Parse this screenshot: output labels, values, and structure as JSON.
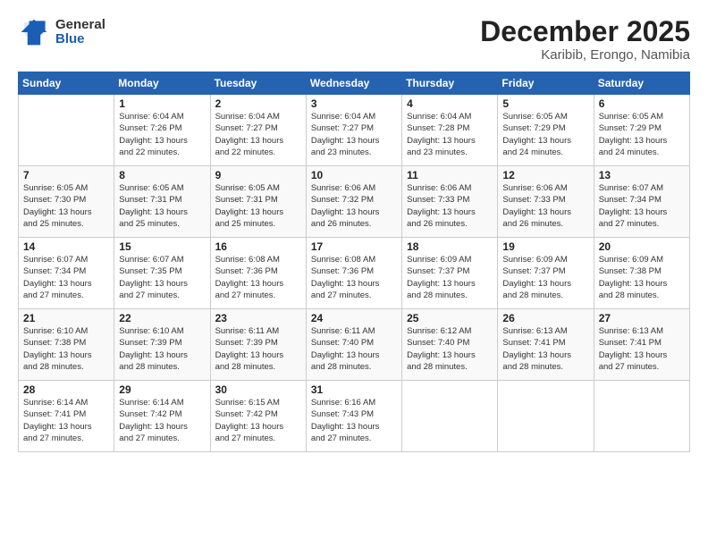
{
  "header": {
    "logo_general": "General",
    "logo_blue": "Blue",
    "month_title": "December 2025",
    "subtitle": "Karibib, Erongo, Namibia"
  },
  "days_of_week": [
    "Sunday",
    "Monday",
    "Tuesday",
    "Wednesday",
    "Thursday",
    "Friday",
    "Saturday"
  ],
  "weeks": [
    [
      {
        "day": "",
        "sunrise": "",
        "sunset": "",
        "daylight": ""
      },
      {
        "day": "1",
        "sunrise": "Sunrise: 6:04 AM",
        "sunset": "Sunset: 7:26 PM",
        "daylight": "Daylight: 13 hours and 22 minutes."
      },
      {
        "day": "2",
        "sunrise": "Sunrise: 6:04 AM",
        "sunset": "Sunset: 7:27 PM",
        "daylight": "Daylight: 13 hours and 22 minutes."
      },
      {
        "day": "3",
        "sunrise": "Sunrise: 6:04 AM",
        "sunset": "Sunset: 7:27 PM",
        "daylight": "Daylight: 13 hours and 23 minutes."
      },
      {
        "day": "4",
        "sunrise": "Sunrise: 6:04 AM",
        "sunset": "Sunset: 7:28 PM",
        "daylight": "Daylight: 13 hours and 23 minutes."
      },
      {
        "day": "5",
        "sunrise": "Sunrise: 6:05 AM",
        "sunset": "Sunset: 7:29 PM",
        "daylight": "Daylight: 13 hours and 24 minutes."
      },
      {
        "day": "6",
        "sunrise": "Sunrise: 6:05 AM",
        "sunset": "Sunset: 7:29 PM",
        "daylight": "Daylight: 13 hours and 24 minutes."
      }
    ],
    [
      {
        "day": "7",
        "sunrise": "Sunrise: 6:05 AM",
        "sunset": "Sunset: 7:30 PM",
        "daylight": "Daylight: 13 hours and 25 minutes."
      },
      {
        "day": "8",
        "sunrise": "Sunrise: 6:05 AM",
        "sunset": "Sunset: 7:31 PM",
        "daylight": "Daylight: 13 hours and 25 minutes."
      },
      {
        "day": "9",
        "sunrise": "Sunrise: 6:05 AM",
        "sunset": "Sunset: 7:31 PM",
        "daylight": "Daylight: 13 hours and 25 minutes."
      },
      {
        "day": "10",
        "sunrise": "Sunrise: 6:06 AM",
        "sunset": "Sunset: 7:32 PM",
        "daylight": "Daylight: 13 hours and 26 minutes."
      },
      {
        "day": "11",
        "sunrise": "Sunrise: 6:06 AM",
        "sunset": "Sunset: 7:33 PM",
        "daylight": "Daylight: 13 hours and 26 minutes."
      },
      {
        "day": "12",
        "sunrise": "Sunrise: 6:06 AM",
        "sunset": "Sunset: 7:33 PM",
        "daylight": "Daylight: 13 hours and 26 minutes."
      },
      {
        "day": "13",
        "sunrise": "Sunrise: 6:07 AM",
        "sunset": "Sunset: 7:34 PM",
        "daylight": "Daylight: 13 hours and 27 minutes."
      }
    ],
    [
      {
        "day": "14",
        "sunrise": "Sunrise: 6:07 AM",
        "sunset": "Sunset: 7:34 PM",
        "daylight": "Daylight: 13 hours and 27 minutes."
      },
      {
        "day": "15",
        "sunrise": "Sunrise: 6:07 AM",
        "sunset": "Sunset: 7:35 PM",
        "daylight": "Daylight: 13 hours and 27 minutes."
      },
      {
        "day": "16",
        "sunrise": "Sunrise: 6:08 AM",
        "sunset": "Sunset: 7:36 PM",
        "daylight": "Daylight: 13 hours and 27 minutes."
      },
      {
        "day": "17",
        "sunrise": "Sunrise: 6:08 AM",
        "sunset": "Sunset: 7:36 PM",
        "daylight": "Daylight: 13 hours and 27 minutes."
      },
      {
        "day": "18",
        "sunrise": "Sunrise: 6:09 AM",
        "sunset": "Sunset: 7:37 PM",
        "daylight": "Daylight: 13 hours and 28 minutes."
      },
      {
        "day": "19",
        "sunrise": "Sunrise: 6:09 AM",
        "sunset": "Sunset: 7:37 PM",
        "daylight": "Daylight: 13 hours and 28 minutes."
      },
      {
        "day": "20",
        "sunrise": "Sunrise: 6:09 AM",
        "sunset": "Sunset: 7:38 PM",
        "daylight": "Daylight: 13 hours and 28 minutes."
      }
    ],
    [
      {
        "day": "21",
        "sunrise": "Sunrise: 6:10 AM",
        "sunset": "Sunset: 7:38 PM",
        "daylight": "Daylight: 13 hours and 28 minutes."
      },
      {
        "day": "22",
        "sunrise": "Sunrise: 6:10 AM",
        "sunset": "Sunset: 7:39 PM",
        "daylight": "Daylight: 13 hours and 28 minutes."
      },
      {
        "day": "23",
        "sunrise": "Sunrise: 6:11 AM",
        "sunset": "Sunset: 7:39 PM",
        "daylight": "Daylight: 13 hours and 28 minutes."
      },
      {
        "day": "24",
        "sunrise": "Sunrise: 6:11 AM",
        "sunset": "Sunset: 7:40 PM",
        "daylight": "Daylight: 13 hours and 28 minutes."
      },
      {
        "day": "25",
        "sunrise": "Sunrise: 6:12 AM",
        "sunset": "Sunset: 7:40 PM",
        "daylight": "Daylight: 13 hours and 28 minutes."
      },
      {
        "day": "26",
        "sunrise": "Sunrise: 6:13 AM",
        "sunset": "Sunset: 7:41 PM",
        "daylight": "Daylight: 13 hours and 28 minutes."
      },
      {
        "day": "27",
        "sunrise": "Sunrise: 6:13 AM",
        "sunset": "Sunset: 7:41 PM",
        "daylight": "Daylight: 13 hours and 27 minutes."
      }
    ],
    [
      {
        "day": "28",
        "sunrise": "Sunrise: 6:14 AM",
        "sunset": "Sunset: 7:41 PM",
        "daylight": "Daylight: 13 hours and 27 minutes."
      },
      {
        "day": "29",
        "sunrise": "Sunrise: 6:14 AM",
        "sunset": "Sunset: 7:42 PM",
        "daylight": "Daylight: 13 hours and 27 minutes."
      },
      {
        "day": "30",
        "sunrise": "Sunrise: 6:15 AM",
        "sunset": "Sunset: 7:42 PM",
        "daylight": "Daylight: 13 hours and 27 minutes."
      },
      {
        "day": "31",
        "sunrise": "Sunrise: 6:16 AM",
        "sunset": "Sunset: 7:43 PM",
        "daylight": "Daylight: 13 hours and 27 minutes."
      },
      {
        "day": "",
        "sunrise": "",
        "sunset": "",
        "daylight": ""
      },
      {
        "day": "",
        "sunrise": "",
        "sunset": "",
        "daylight": ""
      },
      {
        "day": "",
        "sunrise": "",
        "sunset": "",
        "daylight": ""
      }
    ]
  ]
}
